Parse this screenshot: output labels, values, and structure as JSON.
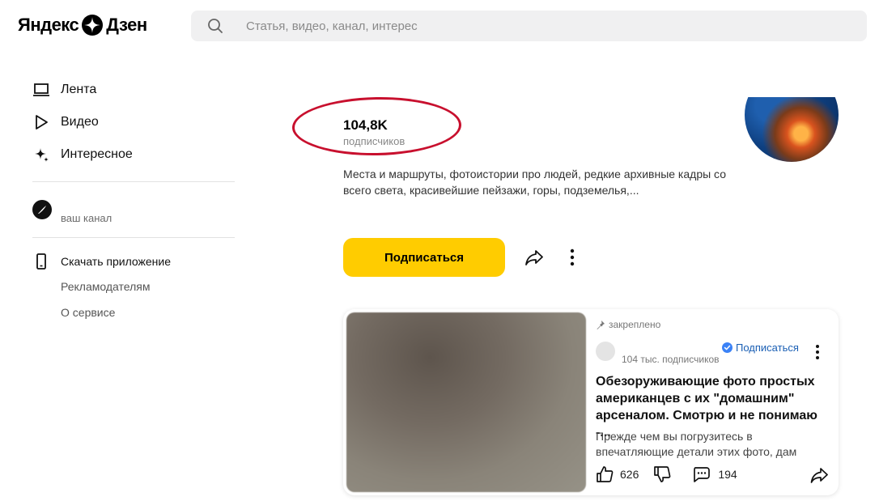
{
  "header": {
    "logo_left": "Яндекс",
    "logo_right": "Дзен",
    "search_placeholder": "Статья, видео, канал, интерес"
  },
  "sidebar": {
    "items": [
      {
        "label": "Лента",
        "icon": "laptop-icon"
      },
      {
        "label": "Видео",
        "icon": "play-icon"
      },
      {
        "label": "Интересное",
        "icon": "sparkle-icon"
      }
    ],
    "channel_label": "ваш канал",
    "download_label": "Скачать приложение",
    "advertisers_label": "Рекламодателям",
    "about_label": "О сервисе"
  },
  "channel": {
    "subscribers_count": "104,8K",
    "subscribers_label": "подписчиков",
    "description": "Места и маршруты, фотоистории про людей, редкие архивные кадры со всего света, красивейшие пейзажи, горы, подземелья,...",
    "subscribe_button": "Подписаться",
    "annotation_color": "#c8102e",
    "accent_color": "#ffcc00"
  },
  "card": {
    "pinned_label": "закреплено",
    "subscribe_link": "Подписаться",
    "subscribers": "104 тыс. подписчиков",
    "title": "Обезоруживающие фото простых американцев с их \"домашним\" арсеналом. Смотрю и не понимаю -...",
    "snippet": "Прежде чем вы погрузитесь в впечатляющие детали этих фото, дам",
    "likes": "626",
    "comments": "194"
  }
}
